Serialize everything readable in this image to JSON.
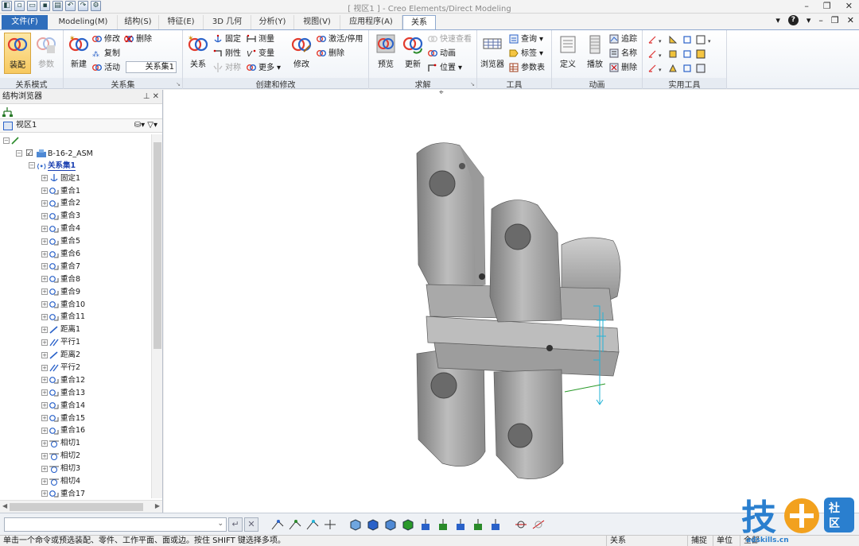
{
  "app": {
    "window_title": "[ 视区1 ] - Creo Elements/Direct Modeling"
  },
  "tabs": [
    {
      "label": "文件(F)"
    },
    {
      "label": "Modeling(M)"
    },
    {
      "label": "结构(S)"
    },
    {
      "label": "特征(E)"
    },
    {
      "label": "3D 几何"
    },
    {
      "label": "分析(Y)"
    },
    {
      "label": "视图(V)"
    },
    {
      "label": "应用程序(A)"
    },
    {
      "label": "关系"
    }
  ],
  "ribbon": {
    "groups": {
      "mode": "关系模式",
      "set": "关系集",
      "create": "创建和修改",
      "solve": "求解",
      "tools": "工具",
      "anim": "动画",
      "util": "实用工具"
    },
    "mode": {
      "assemble": "装配",
      "params": "参数"
    },
    "set": {
      "new": "新建",
      "modify": "修改",
      "copy": "复制",
      "active": "活动",
      "delete": "删除",
      "active_value": "关系集1"
    },
    "create": {
      "relation": "关系",
      "fix": "固定",
      "rigid": "刚性",
      "symmetric": "对称",
      "measure": "测量",
      "variable": "变量",
      "more": "更多",
      "modify": "修改",
      "activate": "激活/停用",
      "delete": "删除"
    },
    "solve": {
      "preview": "预览",
      "update": "更新",
      "quick_view": "快速查看",
      "animation": "动画",
      "position": "位置"
    },
    "tools": {
      "browser": "浏览器",
      "query": "查询",
      "tag": "标签",
      "param_table": "参数表"
    },
    "anim": {
      "define": "定义",
      "play": "播放",
      "trace": "追踪",
      "name": "名称",
      "delete": "删除"
    }
  },
  "browser": {
    "title": "结构浏览器",
    "view": "视区1",
    "items": [
      {
        "label": "",
        "level": 0,
        "icon": "pen-icon"
      },
      {
        "label": "B-16-2_ASM",
        "level": 1,
        "icon": "assembly-icon"
      },
      {
        "label": "关系集1",
        "level": 2,
        "icon": "relation-set-icon"
      },
      {
        "label": "固定1",
        "level": 3,
        "icon": "fix-icon"
      },
      {
        "label": "重合1",
        "level": 3,
        "icon": "coincident-icon"
      },
      {
        "label": "重合2",
        "level": 3,
        "icon": "coincident-icon"
      },
      {
        "label": "重合3",
        "level": 3,
        "icon": "coincident-icon"
      },
      {
        "label": "重合4",
        "level": 3,
        "icon": "coincident-icon"
      },
      {
        "label": "重合5",
        "level": 3,
        "icon": "coincident-icon"
      },
      {
        "label": "重合6",
        "level": 3,
        "icon": "coincident-icon"
      },
      {
        "label": "重合7",
        "level": 3,
        "icon": "coincident-icon"
      },
      {
        "label": "重合8",
        "level": 3,
        "icon": "coincident-icon"
      },
      {
        "label": "重合9",
        "level": 3,
        "icon": "coincident-icon"
      },
      {
        "label": "重合10",
        "level": 3,
        "icon": "coincident-icon"
      },
      {
        "label": "重合11",
        "level": 3,
        "icon": "coincident-icon"
      },
      {
        "label": "距离1",
        "level": 3,
        "icon": "distance-icon"
      },
      {
        "label": "平行1",
        "level": 3,
        "icon": "parallel-icon"
      },
      {
        "label": "距离2",
        "level": 3,
        "icon": "distance-icon"
      },
      {
        "label": "平行2",
        "level": 3,
        "icon": "parallel-icon"
      },
      {
        "label": "重合12",
        "level": 3,
        "icon": "coincident-icon"
      },
      {
        "label": "重合13",
        "level": 3,
        "icon": "coincident-icon"
      },
      {
        "label": "重合14",
        "level": 3,
        "icon": "coincident-icon"
      },
      {
        "label": "重合15",
        "level": 3,
        "icon": "coincident-icon"
      },
      {
        "label": "重合16",
        "level": 3,
        "icon": "coincident-icon"
      },
      {
        "label": "相切1",
        "level": 3,
        "icon": "tangent-icon"
      },
      {
        "label": "相切2",
        "level": 3,
        "icon": "tangent-icon"
      },
      {
        "label": "相切3",
        "level": 3,
        "icon": "tangent-icon"
      },
      {
        "label": "相切4",
        "level": 3,
        "icon": "tangent-icon"
      },
      {
        "label": "重合17",
        "level": 3,
        "icon": "coincident-icon"
      }
    ]
  },
  "statusbar": {
    "message": "单击一个命令或预选装配、零件、工作平面、面或边。按住 SHIFT 键选择多项。",
    "seg1": "关系",
    "seg2": "捕捉",
    "seg3": "单位",
    "seg4": "全部"
  },
  "watermark": {
    "text": "技+社区",
    "url": "adskills.cn"
  },
  "colors": {
    "accent": "#2f6ebc",
    "selection": "#f7c960",
    "part": "#9a9a9a",
    "constraint": "#22b3d6"
  }
}
